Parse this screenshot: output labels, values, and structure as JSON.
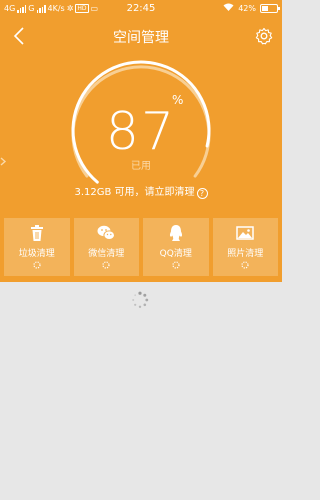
{
  "status_bar": {
    "network_1": "4G",
    "network_2": "G",
    "speed": "4K/s",
    "time": "22:45",
    "battery": "42%",
    "battery_level": 0.42,
    "hd_badge": "HD"
  },
  "header": {
    "title": "空间管理",
    "back_icon": "chevron-left-icon",
    "settings_icon": "gear-icon"
  },
  "gauge": {
    "percent": "87",
    "percent_sign": "%",
    "used_label": "已用",
    "used_fraction": 0.87
  },
  "available_text": "3.12GB 可用，请立即清理",
  "help_icon": "?",
  "cards": [
    {
      "label": "垃圾清理",
      "icon": "trash-icon"
    },
    {
      "label": "微信清理",
      "icon": "wechat-icon"
    },
    {
      "label": "QQ清理",
      "icon": "qq-icon"
    },
    {
      "label": "照片清理",
      "icon": "photo-icon"
    }
  ],
  "colors": {
    "accent": "#f19e2e",
    "card": "#f3b35a",
    "background": "#e7e7e7"
  }
}
